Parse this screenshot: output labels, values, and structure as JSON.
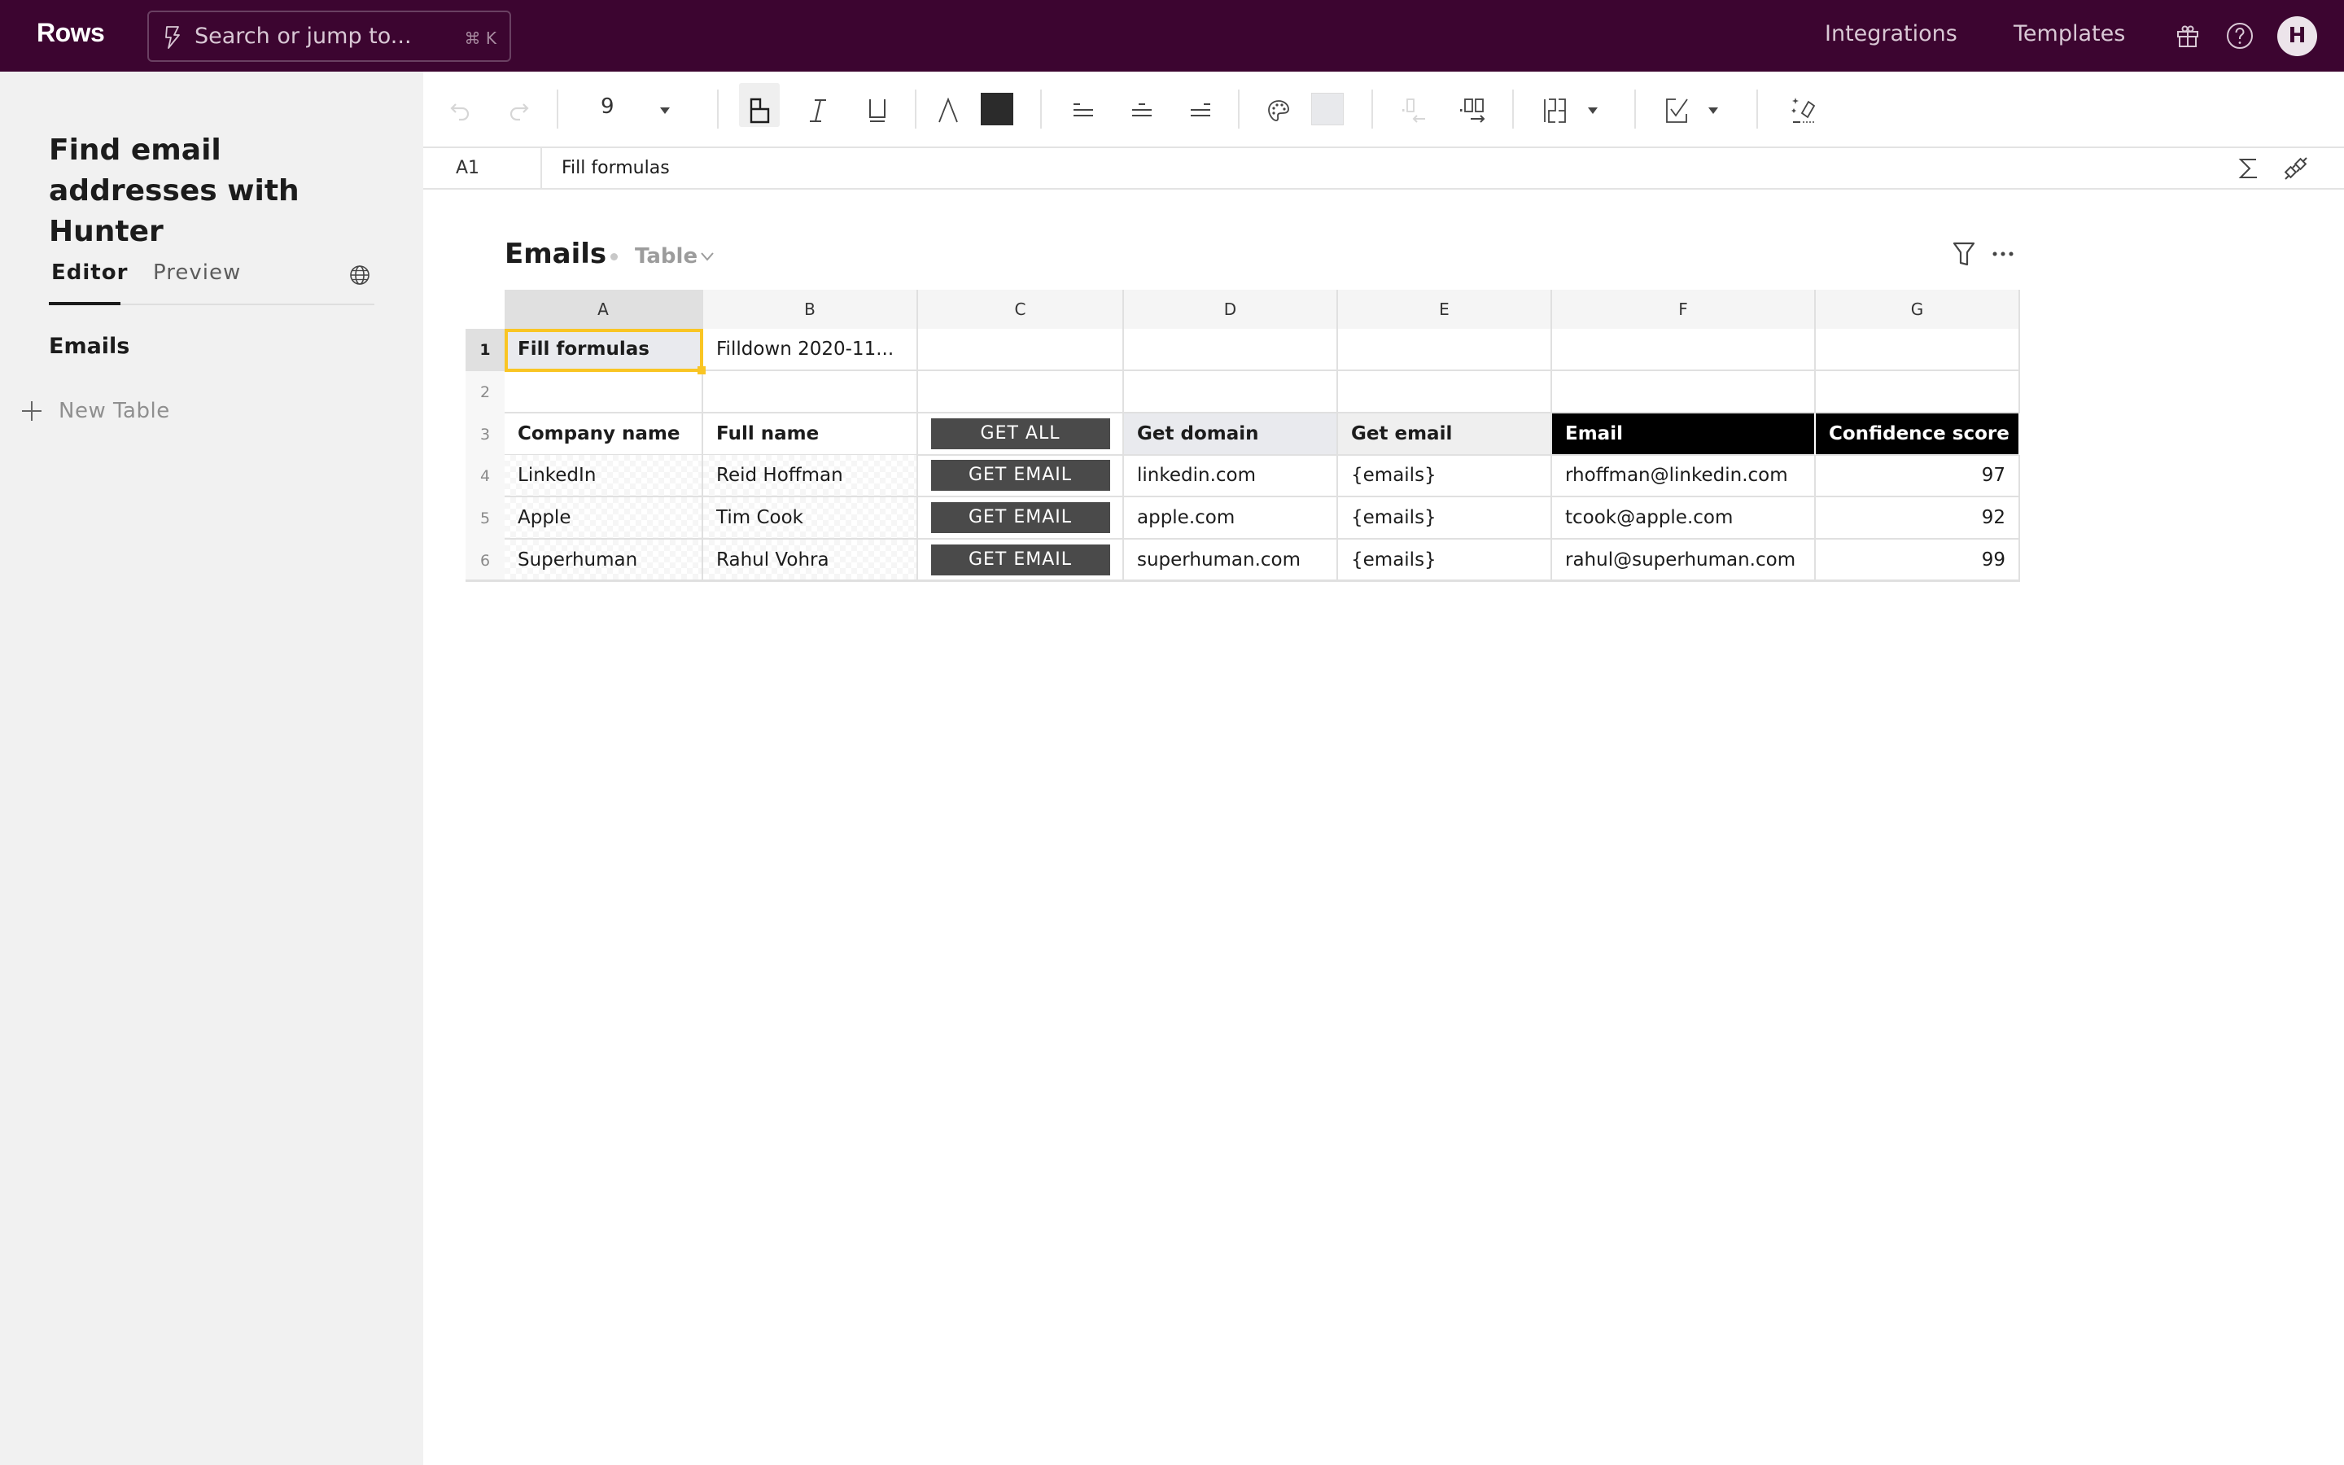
{
  "topbar": {
    "logo": "Rows",
    "search_placeholder": "Search or jump to...",
    "search_shortcut": "⌘ K",
    "nav": [
      "Integrations",
      "Templates"
    ],
    "icons": [
      "gift-icon",
      "help-icon"
    ],
    "avatar_initial": "H"
  },
  "sidebar": {
    "doc_title": "Find email addresses with Hunter",
    "tabs": [
      {
        "label": "Editor",
        "active": true
      },
      {
        "label": "Preview",
        "active": false
      }
    ],
    "sheets": [
      {
        "label": "Emails"
      }
    ],
    "new_table_label": "New Table"
  },
  "toolbar": {
    "font_size": "9",
    "text_color": "#2b2b2b",
    "fill_color": "#e8e9ec",
    "bold_active": true
  },
  "formula_bar": {
    "cell_ref": "A1",
    "value": "Fill formulas"
  },
  "table": {
    "title": "Emails",
    "type_label": "Table",
    "selected_cell": "A1",
    "columns": [
      "A",
      "B",
      "C",
      "D",
      "E",
      "F",
      "G"
    ],
    "rows": [
      {
        "num": "1",
        "cells": [
          "Fill formulas",
          "Filldown 2020-11...",
          "",
          "",
          "",
          "",
          ""
        ]
      },
      {
        "num": "2",
        "cells": [
          "",
          "",
          "",
          "",
          "",
          "",
          ""
        ]
      },
      {
        "num": "3",
        "cells": [
          "Company name",
          "Full name",
          "GET ALL",
          "Get domain",
          "Get email",
          "Email",
          "Confidence score"
        ]
      },
      {
        "num": "4",
        "cells": [
          "LinkedIn",
          "Reid Hoffman",
          "GET EMAIL",
          "linkedin.com",
          "{emails}",
          "rhoffman@linkedin.com",
          "97"
        ]
      },
      {
        "num": "5",
        "cells": [
          "Apple",
          "Tim Cook",
          "GET EMAIL",
          "apple.com",
          "{emails}",
          "tcook@apple.com",
          "92"
        ]
      },
      {
        "num": "6",
        "cells": [
          "Superhuman",
          "Rahul Vohra",
          "GET EMAIL",
          "superhuman.com",
          "{emails}",
          "rahul@superhuman.com",
          "99"
        ]
      }
    ]
  },
  "colors": {
    "brand": "#3c0530",
    "selection": "#f9c524",
    "button": "#4a4a4a",
    "header_black": "#000000"
  }
}
